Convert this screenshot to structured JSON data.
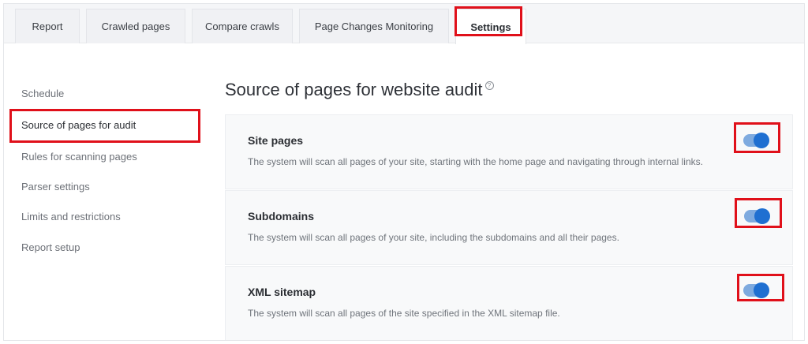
{
  "tabs": [
    {
      "label": "Report"
    },
    {
      "label": "Crawled pages"
    },
    {
      "label": "Compare crawls"
    },
    {
      "label": "Page Changes Monitoring"
    },
    {
      "label": "Settings",
      "active": true
    }
  ],
  "sidebar": {
    "items": [
      {
        "label": "Schedule"
      },
      {
        "label": "Source of pages for audit",
        "active": true
      },
      {
        "label": "Rules for scanning pages"
      },
      {
        "label": "Parser settings"
      },
      {
        "label": "Limits and restrictions"
      },
      {
        "label": "Report setup"
      }
    ]
  },
  "main": {
    "title": "Source of pages for website audit",
    "help_icon": "?",
    "sources": [
      {
        "title": "Site pages",
        "description": "The system will scan all pages of your site, starting with the home page and navigating through internal links.",
        "enabled": true
      },
      {
        "title": "Subdomains",
        "description": "The system will scan all pages of your site, including the subdomains and all their pages.",
        "enabled": true
      },
      {
        "title": "XML sitemap",
        "description": "The system will scan all pages of the site specified in the XML sitemap file.",
        "enabled": true
      }
    ]
  },
  "colors": {
    "highlight": "#e0101a",
    "toggle_on": "#1f6fd1",
    "toggle_track": "#7eaadf"
  }
}
